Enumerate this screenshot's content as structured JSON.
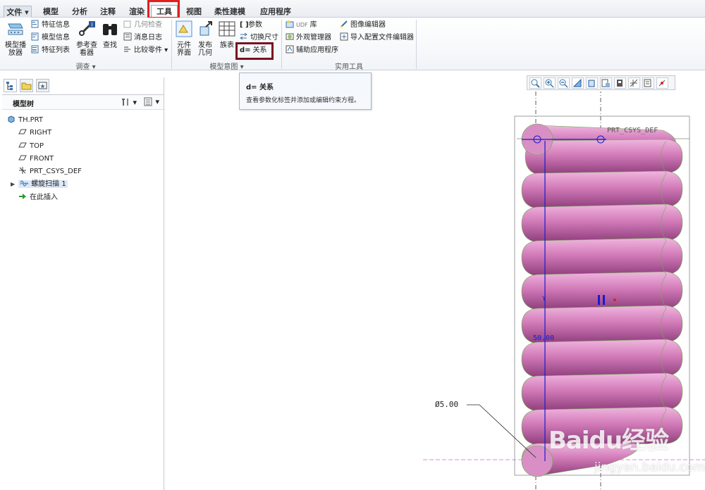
{
  "tabs": [
    {
      "label": "文件"
    },
    {
      "label": "模型"
    },
    {
      "label": "分析"
    },
    {
      "label": "注释"
    },
    {
      "label": "渲染"
    },
    {
      "label": "工具"
    },
    {
      "label": "视图"
    },
    {
      "label": "柔性建模"
    },
    {
      "label": "应用程序"
    }
  ],
  "ribbon": {
    "investigate": {
      "model_player": "模型播\n放器",
      "feature_info": "特征信息",
      "model_info": "模型信息",
      "feature_list": "特征列表",
      "ref_viewer": "参考查\n看器",
      "find": "查找",
      "geom_check": "几何检查",
      "message_log": "消息日志",
      "compare_part": "比较零件",
      "group": "调查"
    },
    "model_intent": {
      "element_ui": "元件\n界面",
      "publish_geom": "发布\n几何",
      "family_table": "族表",
      "params": "参数",
      "switch_dims": "切换尺寸",
      "relations": "关系",
      "relations_prefix": "d=",
      "group": "模型意图"
    },
    "utilities": {
      "udf_lib": "库",
      "udf_prefix": "UDF",
      "appearance_mgr": "外观管理器",
      "aux_apps": "辅助应用程序",
      "image_editor": "图像编辑器",
      "import_config_editor": "导入配置文件编辑器",
      "group": "实用工具"
    }
  },
  "tooltip": {
    "title_prefix": "d=",
    "title": "关系",
    "desc": "查看参数化标签并添加或编辑约束方程。"
  },
  "model_tree": {
    "title": "模型树",
    "items": [
      {
        "label": "TH.PRT",
        "icon": "part-icon"
      },
      {
        "label": "RIGHT",
        "icon": "datum-plane-icon"
      },
      {
        "label": "TOP",
        "icon": "datum-plane-icon"
      },
      {
        "label": "FRONT",
        "icon": "datum-plane-icon"
      },
      {
        "label": "PRT_CSYS_DEF",
        "icon": "csys-icon"
      },
      {
        "label": "螺旋扫描 1",
        "icon": "helical-sweep-icon"
      },
      {
        "label": "在此插入",
        "icon": "insert-here-arrow-icon"
      }
    ]
  },
  "graphics": {
    "csys_label": "PRT_CSYS_DEF",
    "dim_height": "50.00",
    "dim_diameter": "Ø5.00",
    "axis_label": "Y",
    "spring_color": "#d27ab8",
    "edge_color": "#6ab04c",
    "sketch_color": "#1a1ad0"
  },
  "watermark": {
    "logo": "Baidu经验",
    "url": "jingyan.baidu.com"
  }
}
